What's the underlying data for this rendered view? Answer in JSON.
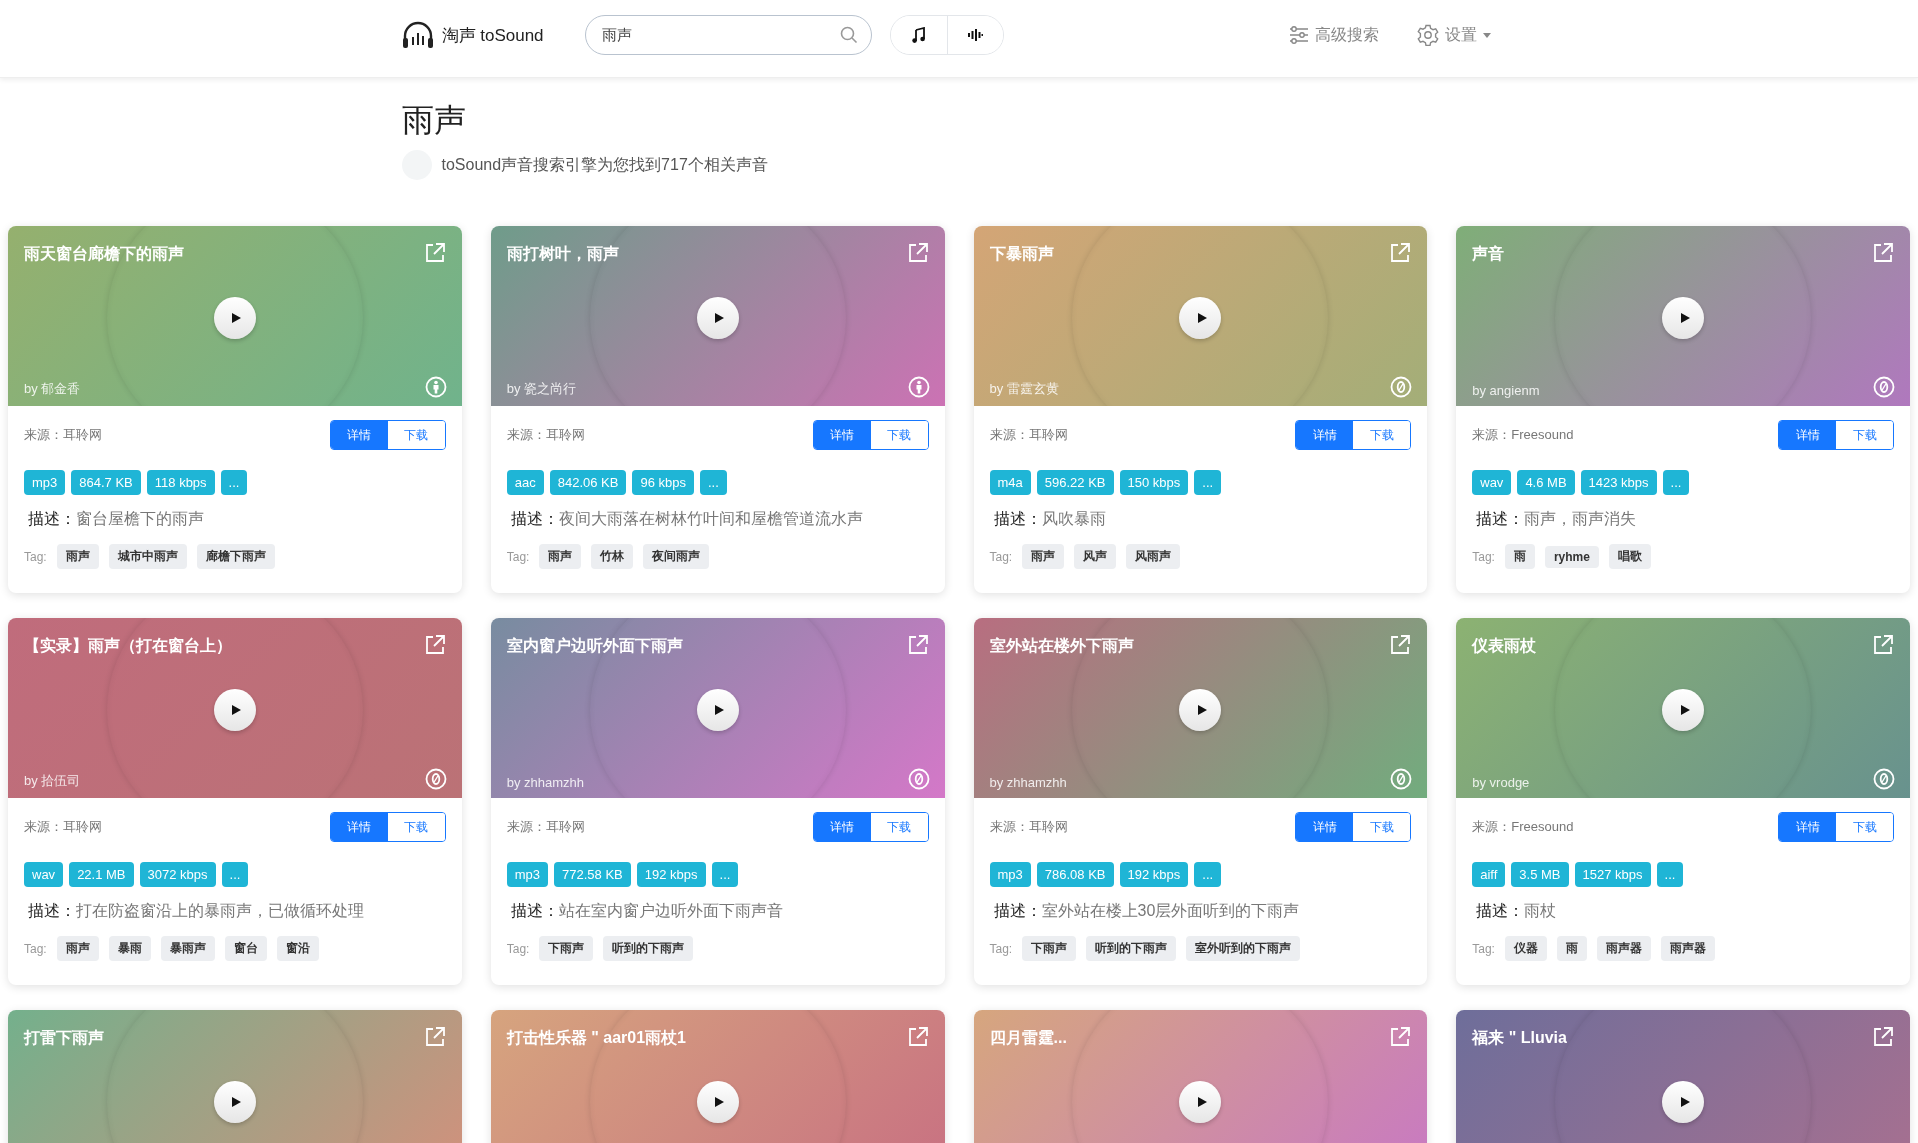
{
  "header": {
    "brand": "淘声 toSound",
    "search": {
      "value": "雨声"
    },
    "nav": [
      {
        "label": "高级搜索",
        "kind": "filter"
      },
      {
        "label": "设置",
        "kind": "settings"
      }
    ]
  },
  "page": {
    "title": "雨声",
    "summary": "toSound声音搜索引擎为您找到717个相关声音"
  },
  "cards": [
    {
      "title": "雨天窗台廊檐下的雨声",
      "author": "by 郁金香",
      "kind": "attribution",
      "source": "来源：耳聆网",
      "buttons": [
        {
          "label": "详情",
          "primary": true
        },
        {
          "label": "下载",
          "primary": false
        }
      ],
      "badges": [
        "mp3",
        "864.7 KB",
        "118 kbps",
        "..."
      ],
      "desc_label": "描述：",
      "description": "窗台屋檐下的雨声",
      "tag_label": "Tag:",
      "tags": [
        "雨声",
        "城市中雨声",
        "廊檐下雨声"
      ]
    },
    {
      "title": "雨打树叶，雨声",
      "author": "by 瓷之尚行",
      "kind": "attribution",
      "source": "来源：耳聆网",
      "buttons": [
        {
          "label": "详情",
          "primary": true
        },
        {
          "label": "下载",
          "primary": false
        }
      ],
      "badges": [
        "aac",
        "842.06 KB",
        "96 kbps",
        "..."
      ],
      "desc_label": "描述：",
      "description": "夜间大雨落在树林竹叶间和屋檐管道流水声",
      "tag_label": "Tag:",
      "tags": [
        "雨声",
        "竹林",
        "夜间雨声"
      ]
    },
    {
      "title": "下暴雨声",
      "author": "by 雷霆玄黄",
      "kind": "cc0",
      "source": "来源：耳聆网",
      "buttons": [
        {
          "label": "详情",
          "primary": true
        },
        {
          "label": "下载",
          "primary": false
        }
      ],
      "badges": [
        "m4a",
        "596.22 KB",
        "150 kbps",
        "..."
      ],
      "desc_label": "描述：",
      "description": "风吹暴雨",
      "tag_label": "Tag:",
      "tags": [
        "雨声",
        "风声",
        "风雨声"
      ]
    },
    {
      "title": "声音",
      "author": "by angienm",
      "kind": "cc0",
      "source": "来源：Freesound",
      "buttons": [
        {
          "label": "详情",
          "primary": true
        },
        {
          "label": "下载",
          "primary": false
        }
      ],
      "badges": [
        "wav",
        "4.6 MB",
        "1423 kbps",
        "..."
      ],
      "desc_label": "描述：",
      "description": "雨声，雨声消失",
      "tag_label": "Tag:",
      "tags": [
        "雨",
        "ryhme",
        "唱歌"
      ]
    },
    {
      "title": "【实录】雨声（打在窗台上）",
      "author": "by 拾伍司",
      "kind": "cc0",
      "source": "来源：耳聆网",
      "buttons": [
        {
          "label": "详情",
          "primary": true
        },
        {
          "label": "下载",
          "primary": false
        }
      ],
      "badges": [
        "wav",
        "22.1 MB",
        "3072 kbps",
        "..."
      ],
      "desc_label": "描述：",
      "description": "打在防盗窗沿上的暴雨声，已做循环处理",
      "tag_label": "Tag:",
      "tags": [
        "雨声",
        "暴雨",
        "暴雨声",
        "窗台",
        "窗沿"
      ]
    },
    {
      "title": "室内窗户边听外面下雨声",
      "author": "by zhhamzhh",
      "kind": "cc0",
      "source": "来源：耳聆网",
      "buttons": [
        {
          "label": "详情",
          "primary": true
        },
        {
          "label": "下载",
          "primary": false
        }
      ],
      "badges": [
        "mp3",
        "772.58 KB",
        "192 kbps",
        "..."
      ],
      "desc_label": "描述：",
      "description": "站在室内窗户边听外面下雨声音",
      "tag_label": "Tag:",
      "tags": [
        "下雨声",
        "听到的下雨声"
      ]
    },
    {
      "title": "室外站在楼外下雨声",
      "author": "by zhhamzhh",
      "kind": "cc0",
      "source": "来源：耳聆网",
      "buttons": [
        {
          "label": "详情",
          "primary": true
        },
        {
          "label": "下载",
          "primary": false
        }
      ],
      "badges": [
        "mp3",
        "786.08 KB",
        "192 kbps",
        "..."
      ],
      "desc_label": "描述：",
      "description": "室外站在楼上30层外面听到的下雨声",
      "tag_label": "Tag:",
      "tags": [
        "下雨声",
        "听到的下雨声",
        "室外听到的下雨声"
      ]
    },
    {
      "title": "仪表雨杖",
      "author": "by vrodge",
      "kind": "cc0",
      "source": "来源：Freesound",
      "buttons": [
        {
          "label": "详情",
          "primary": true
        },
        {
          "label": "下载",
          "primary": false
        }
      ],
      "badges": [
        "aiff",
        "3.5 MB",
        "1527 kbps",
        "..."
      ],
      "desc_label": "描述：",
      "description": "雨杖",
      "tag_label": "Tag:",
      "tags": [
        "仪器",
        "雨",
        "雨声器",
        "雨声器"
      ]
    },
    {
      "title": "打雷下雨声"
    },
    {
      "title": "打击性乐器 \" aar01雨杖1"
    },
    {
      "title": "四月雷霆..."
    },
    {
      "title": "福来 \" Lluvia"
    }
  ]
}
